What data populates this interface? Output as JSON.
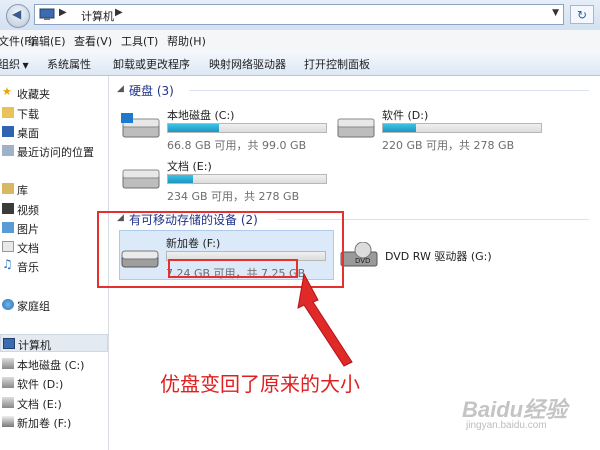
{
  "address": {
    "path": "计算机"
  },
  "menu": [
    "文件(F)",
    "编辑(E)",
    "查看(V)",
    "工具(T)",
    "帮助(H)"
  ],
  "toolbar": {
    "organize": "组织",
    "items": [
      "系统属性",
      "卸载或更改程序",
      "映射网络驱动器",
      "打开控制面板"
    ]
  },
  "nav": {
    "favorites": "收藏夹",
    "favorite_items": [
      "下载",
      "桌面",
      "最近访问的位置"
    ],
    "libraries": "库",
    "library_items": [
      "视频",
      "图片",
      "文档",
      "音乐"
    ],
    "homegroup": "家庭组",
    "computer": "计算机",
    "computer_items": [
      "本地磁盘 (C:)",
      "软件 (D:)",
      "文档 (E:)",
      "新加卷 (F:)"
    ]
  },
  "content": {
    "hdd_title": "硬盘 (3)",
    "removable_title": "有可移动存储的设备 (2)",
    "drives": [
      {
        "name": "本地磁盘 (C:)",
        "info": "66.8 GB 可用，共 99.0 GB",
        "used_fraction": 0.325
      },
      {
        "name": "软件 (D:)",
        "info": "220 GB 可用，共 278 GB",
        "used_fraction": 0.209
      },
      {
        "name": "文档 (E:)",
        "info": "234 GB 可用，共 278 GB",
        "used_fraction": 0.158
      },
      {
        "name": "新加卷 (F:)",
        "info": "7.24 GB 可用，共 7.25 GB",
        "used_fraction": 0.001
      },
      {
        "name": "DVD RW 驱动器 (G:)",
        "info": ""
      }
    ]
  },
  "annotation": "优盘变回了原来的大小",
  "watermark": {
    "brand": "Baidu经验",
    "url": "jingyan.baidu.com"
  },
  "colors": {
    "accent": "#1e3287",
    "annotation_red": "#e02020",
    "drive_bar": "#1d95c3"
  }
}
